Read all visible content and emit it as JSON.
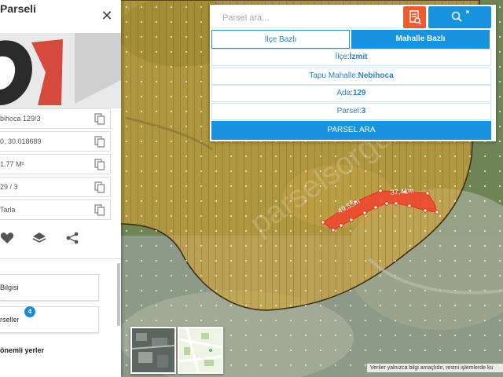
{
  "panel": {
    "title": "Parseli",
    "info_rows": [
      {
        "text": "bihoca 129/3"
      },
      {
        "text": "0, 30.018689"
      },
      {
        "text": "1.77 M²"
      },
      {
        "text": "29 / 3"
      },
      {
        "text": "Tarla"
      }
    ],
    "menu": [
      {
        "label": "Bilgisi"
      },
      {
        "label": "rseller",
        "badge": "4"
      }
    ],
    "important_places": "önemli yerler",
    "icons": [
      "close-icon",
      "copy-icon",
      "heart-icon",
      "layers-icon",
      "share-icon"
    ]
  },
  "search": {
    "placeholder": "Parsel ara...",
    "tabs": [
      "İlçe Bazlı",
      "Mahalle Bazlı"
    ],
    "fields": {
      "ilce_label": "İlçe:",
      "ilce_value": "İzmit",
      "mahalle_label": "Tapu Mahalle:",
      "mahalle_value": "Nebihoca",
      "ada_label": "Ada:",
      "ada_value": "129",
      "parsel_label": "Parsel:",
      "parsel_value": "3"
    },
    "submit": "PARSEL ARA",
    "icons": [
      "document-search-icon",
      "magnifier-icon"
    ]
  },
  "map": {
    "measurements": [
      "49,55m",
      "37,41m"
    ],
    "watermark": "parselsorgu",
    "disclaimer": "Veriler yalnızca bilgi amaçlıdır, resmi işlemlerde ku",
    "colors": {
      "zone_fill": "#d9a431",
      "zone_stroke": "#3a2a12",
      "parcel": "#f2432b"
    }
  }
}
